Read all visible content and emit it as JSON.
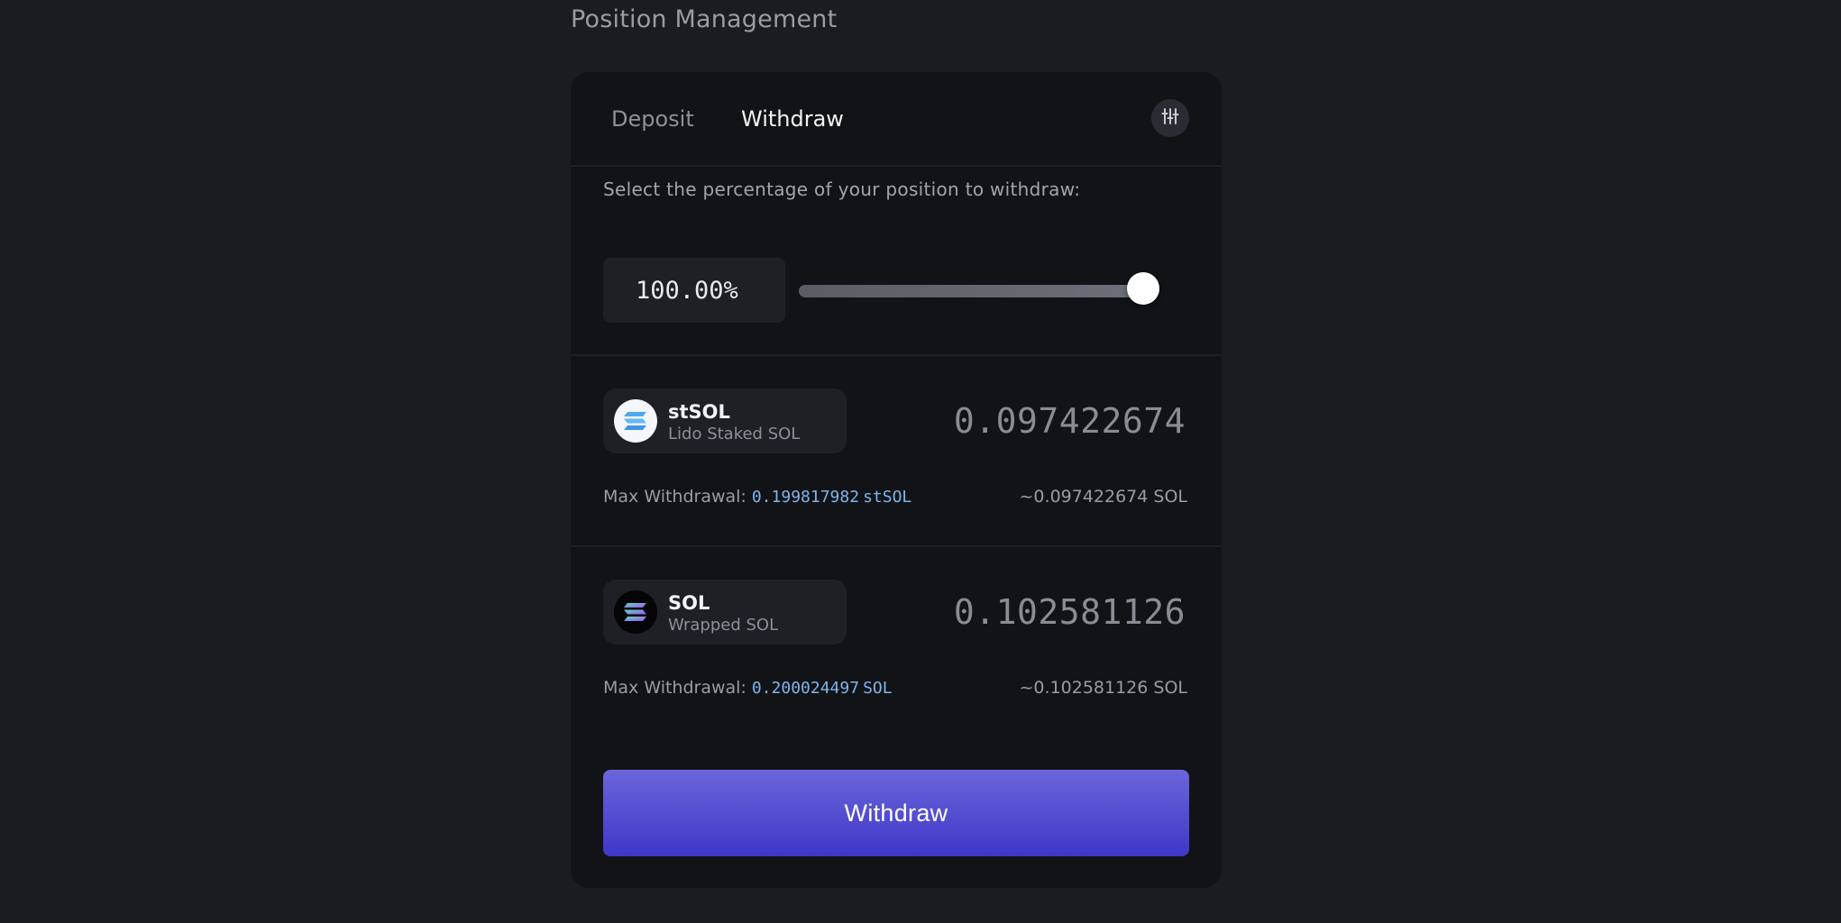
{
  "page": {
    "title": "Position Management"
  },
  "tabs": {
    "deposit": "Deposit",
    "withdraw": "Withdraw",
    "active": "Withdraw"
  },
  "withdraw_form": {
    "instruction": "Select the percentage of your position to withdraw:",
    "percentage_text": "100.00%",
    "percentage_value": 1.0
  },
  "tokens": [
    {
      "symbol": "stSOL",
      "name": "Lido Staked SOL",
      "amount": "0.097422674",
      "max_label": "Max Withdrawal:",
      "max_value": "0.199817982",
      "max_unit": "stSOL",
      "approx": "~0.097422674 SOL",
      "logo_icon": "stsol-logo-icon"
    },
    {
      "symbol": "SOL",
      "name": "Wrapped SOL",
      "amount": "0.102581126",
      "max_label": "Max Withdrawal:",
      "max_value": "0.200024497",
      "max_unit": "SOL",
      "approx": "~0.102581126 SOL",
      "logo_icon": "sol-logo-icon"
    }
  ],
  "actions": {
    "withdraw_button": "Withdraw"
  },
  "colors": {
    "background": "#1b1c20",
    "card": "#121317",
    "accent_link": "#7fb4ea",
    "button_gradient_top": "#6a66da",
    "button_gradient_bottom": "#3f37c9"
  }
}
